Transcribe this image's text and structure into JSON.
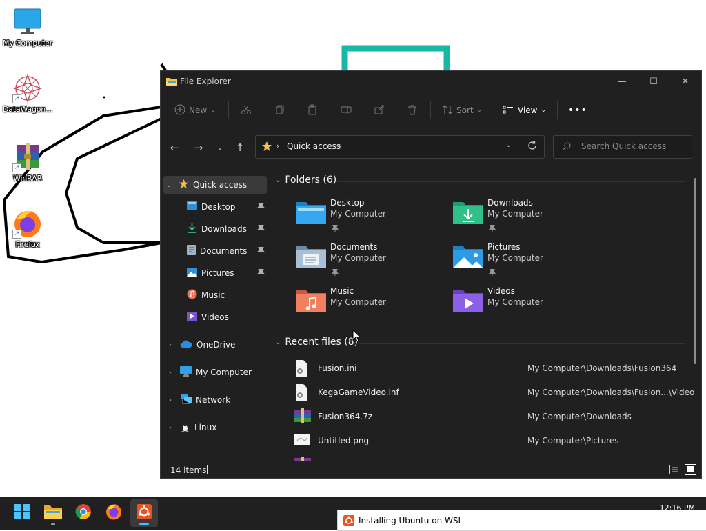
{
  "desktop": {
    "icons": [
      {
        "label": "My Computer",
        "icon": "monitor-icon"
      },
      {
        "label": "DataWagon...",
        "icon": "datawagon-icon"
      },
      {
        "label": "WinRAR",
        "icon": "winrar-icon"
      },
      {
        "label": "Firefox",
        "icon": "firefox-icon"
      }
    ]
  },
  "window": {
    "title": "File Explorer",
    "controls": {
      "minimize": "—",
      "maximize": "☐",
      "close": "✕"
    },
    "commandbar": {
      "new_label": "New",
      "sort_label": "Sort",
      "view_label": "View",
      "more_label": "•••"
    },
    "address": {
      "location": "Quick access"
    },
    "search": {
      "placeholder": "Search Quick access"
    },
    "sidebar": {
      "items": [
        {
          "label": "Quick access",
          "icon": "star-icon"
        },
        {
          "label": "Desktop",
          "icon": "desktop-folder-icon",
          "pinned": true
        },
        {
          "label": "Downloads",
          "icon": "download-icon",
          "pinned": true
        },
        {
          "label": "Documents",
          "icon": "document-icon",
          "pinned": true
        },
        {
          "label": "Pictures",
          "icon": "pictures-icon",
          "pinned": true
        },
        {
          "label": "Music",
          "icon": "music-icon"
        },
        {
          "label": "Videos",
          "icon": "videos-icon"
        },
        {
          "label": "OneDrive",
          "icon": "cloud-icon"
        },
        {
          "label": "My Computer",
          "icon": "computer-icon"
        },
        {
          "label": "Network",
          "icon": "network-icon"
        },
        {
          "label": "Linux",
          "icon": "linux-icon"
        }
      ]
    },
    "folders_section": {
      "heading": "Folders (6)",
      "folders": [
        {
          "name": "Desktop",
          "location": "My Computer",
          "pinned": true
        },
        {
          "name": "Downloads",
          "location": "My Computer",
          "pinned": true
        },
        {
          "name": "Documents",
          "location": "My Computer",
          "pinned": true
        },
        {
          "name": "Pictures",
          "location": "My Computer",
          "pinned": true
        },
        {
          "name": "Music",
          "location": "My Computer",
          "pinned": false
        },
        {
          "name": "Videos",
          "location": "My Computer",
          "pinned": false
        }
      ]
    },
    "recent_section": {
      "heading": "Recent files (8)",
      "files": [
        {
          "name": "Fusion.ini",
          "path": "My Computer\\Downloads\\Fusion364",
          "icon": "ini-file-icon"
        },
        {
          "name": "KegaGameVideo.inf",
          "path": "My Computer\\Downloads\\Fusion...\\Video Codec",
          "icon": "inf-file-icon"
        },
        {
          "name": "Fusion364.7z",
          "path": "My Computer\\Downloads",
          "icon": "archive-file-icon"
        },
        {
          "name": "Untitled.png",
          "path": "My Computer\\Pictures",
          "icon": "image-file-icon"
        }
      ]
    },
    "status": {
      "item_count": "14 items"
    }
  },
  "taskbar": {
    "clock_time": "12:16 PM",
    "notification": "Installing Ubuntu on WSL"
  },
  "colors": {
    "window_bg": "#202020",
    "accent": "#4cc2ff",
    "folder_yellow": "#f5c242"
  }
}
